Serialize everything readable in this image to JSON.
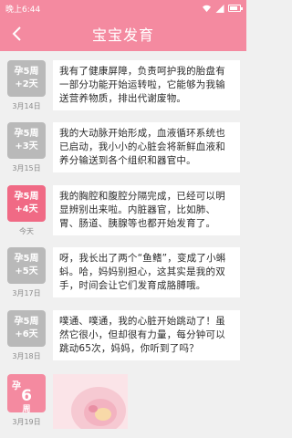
{
  "status_bar": {
    "time": "晚上6:44"
  },
  "header": {
    "title": "宝宝发育",
    "back_icon": "chevron-left-icon"
  },
  "colors": {
    "brand": "#f48aa0",
    "active_badge": "#f06a85",
    "inactive_badge": "#b9b9b9"
  },
  "entries": [
    {
      "week": "孕5周",
      "day": "+2天",
      "date": "3月14日",
      "text": "我有了健康屏障，负责呵护我的胎盘有一部分功能开始运转啦，它能够为我输送营养物质，排出代谢废物。"
    },
    {
      "week": "孕5周",
      "day": "+3天",
      "date": "3月15日",
      "text": "我的大动脉开始形成，血液循环系统也已启动，我小小的心脏会将新鲜血液和养分输送到各个组织和器官中。"
    },
    {
      "week": "孕5周",
      "day": "+4天",
      "date": "今天",
      "text": "我的胸腔和腹腔分隔完成，已经可以明显辨别出来啦。内脏器官，比如肺、胃、肠道、胰腺等也都开始发育了。"
    },
    {
      "week": "孕5周",
      "day": "+5天",
      "date": "3月17日",
      "text": "呀，我长出了两个“鱼鳍”，变成了小蝌蚪。哈，妈妈别担心，这其实是我的双手，时间会让它们发育成胳膊哦。"
    },
    {
      "week": "孕5周",
      "day": "+6天",
      "date": "3月18日",
      "text": "噗通、噗通，我的心脏开始跳动了！虽然它很小，但却很有力量，每分钟可以跳动65次，妈妈，你听到了吗？"
    }
  ],
  "week_entry": {
    "prefix": "孕",
    "number": "6",
    "unit": "周",
    "date": "3月19日"
  }
}
